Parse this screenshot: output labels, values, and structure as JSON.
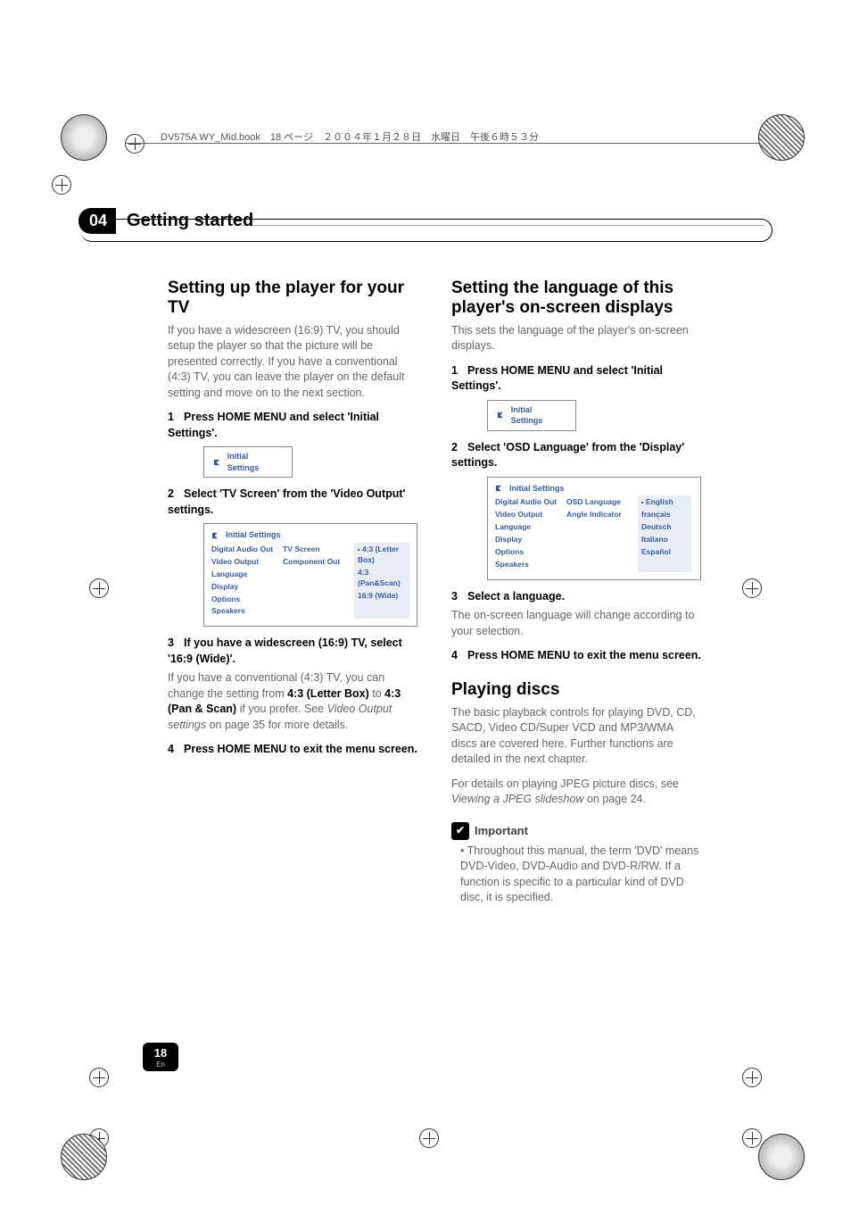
{
  "header": {
    "runningHead": "DV575A WY_Mid.book　18 ページ　２００４年１月２８日　水曜日　午後６時５３分"
  },
  "chapter": {
    "number": "04",
    "title": "Getting started"
  },
  "left": {
    "h1": "Setting up the player for your TV",
    "intro": "If you have a widescreen (16:9) TV, you should setup the player so that the picture will be presented correctly. If you have a conventional (4:3) TV, you can leave the player on the default setting and move on to the next section.",
    "step1": "Press HOME MENU and select 'Initial Settings'.",
    "shot1": "Initial Settings",
    "step2": "Select 'TV Screen' from the 'Video Output' settings.",
    "shot2": {
      "title": "Initial Settings",
      "colA": [
        "Digital Audio Out",
        "Video Output",
        "Language",
        "Display",
        "Options",
        "Speakers"
      ],
      "colB": [
        "TV Screen",
        "Component Out"
      ],
      "colC": [
        "4:3 (Letter Box)",
        "4:3 (Pan&Scan)",
        "16:9 (Wide)"
      ]
    },
    "step3": "If you have a widescreen (16:9) TV, select '16:9 (Wide)'.",
    "step3body_a": "If you have a conventional (4:3) TV, you can change the setting from ",
    "step3body_b": "4:3 (Letter Box)",
    "step3body_c": " to ",
    "step3body_d": "4:3 (Pan & Scan)",
    "step3body_e": " if you prefer. See ",
    "step3body_f": "Video Output settings",
    "step3body_g": " on page 35 for more details.",
    "step4": "Press HOME MENU to exit the menu screen."
  },
  "right": {
    "h1": "Setting the language of this player's on-screen displays",
    "intro": "This sets the language of the player's on-screen displays.",
    "step1": "Press HOME MENU and select 'Initial Settings'.",
    "shot1": "Initial Settings",
    "step2": "Select 'OSD Language' from the 'Display' settings.",
    "shot2": {
      "title": "Initial Settings",
      "colA": [
        "Digital Audio Out",
        "Video Output",
        "Language",
        "Display",
        "Options",
        "Speakers"
      ],
      "colB": [
        "OSD Language",
        "Angle Indicator"
      ],
      "colC": [
        "English",
        "français",
        "Deutsch",
        "Italiano",
        "Español"
      ]
    },
    "step3": "Select a language.",
    "step3body": "The on-screen language will change according to your selection.",
    "step4": "Press HOME MENU to exit the menu screen.",
    "h2": "Playing discs",
    "play_intro": "The basic playback controls for playing DVD, CD, SACD, Video CD/Super VCD and MP3/WMA discs are covered here. Further functions are detailed in the next chapter.",
    "play_jpeg_a": "For details on playing JPEG picture discs, see ",
    "play_jpeg_b": "Viewing a JPEG slideshow",
    "play_jpeg_c": " on page 24.",
    "important_label": "Important",
    "important_bullet": "Throughout this manual, the term 'DVD' means DVD-Video, DVD-Audio and DVD-R/RW. If a function is specific to a particular kind of DVD disc, it is specified."
  },
  "pageBadge": {
    "num": "18",
    "lang": "En"
  }
}
